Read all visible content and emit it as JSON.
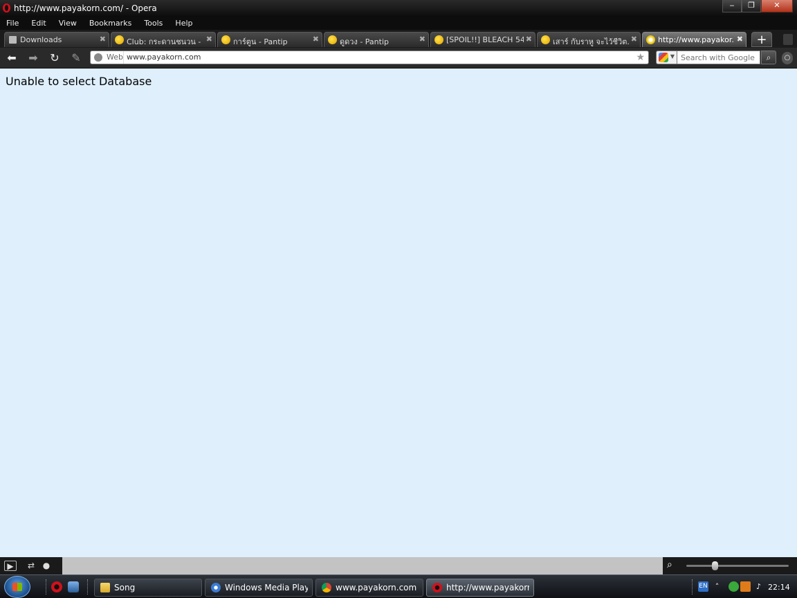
{
  "window": {
    "title": "http://www.payakorn.com/ - Opera",
    "minimize_label": "‒",
    "maximize_label": "❐",
    "close_label": "✕"
  },
  "menu": [
    "File",
    "Edit",
    "View",
    "Bookmarks",
    "Tools",
    "Help"
  ],
  "tabs": [
    {
      "label": "Downloads",
      "icon": "download-icon"
    },
    {
      "label": "Club: กระดานชนวน - ...",
      "icon": "pantip-icon"
    },
    {
      "label": "การ์ตูน - Pantip",
      "icon": "pantip-icon"
    },
    {
      "label": "ดูดวง - Pantip",
      "icon": "pantip-icon"
    },
    {
      "label": "[SPOIL!!] BLEACH 54...",
      "icon": "pantip-icon"
    },
    {
      "label": "เสาร์ กับราหู จะไว้ชีวิต...",
      "icon": "pantip-icon"
    },
    {
      "label": "http://www.payakor...",
      "icon": "loading-icon",
      "active": true
    }
  ],
  "tab_close_label": "✖",
  "new_tab_label": "+",
  "navbar": {
    "address_web_label": "Web",
    "address_url": "www.payakorn.com",
    "search_placeholder": "Search with Google"
  },
  "content": {
    "message": "Unable to select Database"
  },
  "taskbar": {
    "tasks": [
      {
        "label": "Song",
        "icon": "folder-icon"
      },
      {
        "label": "Windows Media Player",
        "icon": "media-player-icon"
      },
      {
        "label": "www.payakorn.com - ...",
        "icon": "chrome-icon"
      },
      {
        "label": "http://www.payakorn...",
        "icon": "opera-icon",
        "active": true
      }
    ],
    "language": "EN",
    "clock": "22:14"
  },
  "colors": {
    "content_background": "#dfeffc",
    "opera_red": "#d0111b"
  }
}
